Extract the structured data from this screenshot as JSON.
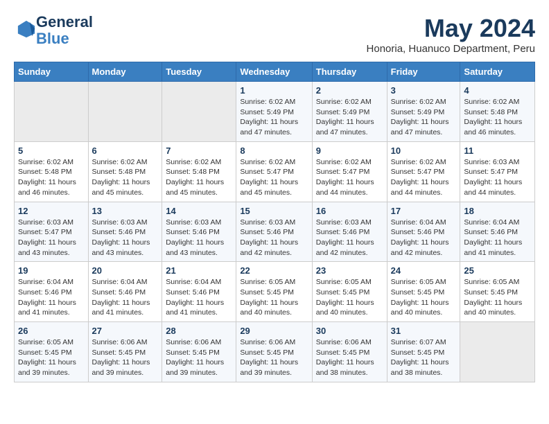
{
  "header": {
    "logo_line1": "General",
    "logo_line2": "Blue",
    "month_year": "May 2024",
    "location": "Honoria, Huanuco Department, Peru"
  },
  "days_of_week": [
    "Sunday",
    "Monday",
    "Tuesday",
    "Wednesday",
    "Thursday",
    "Friday",
    "Saturday"
  ],
  "weeks": [
    [
      {
        "day": "",
        "info": ""
      },
      {
        "day": "",
        "info": ""
      },
      {
        "day": "",
        "info": ""
      },
      {
        "day": "1",
        "info": "Sunrise: 6:02 AM\nSunset: 5:49 PM\nDaylight: 11 hours and 47 minutes."
      },
      {
        "day": "2",
        "info": "Sunrise: 6:02 AM\nSunset: 5:49 PM\nDaylight: 11 hours and 47 minutes."
      },
      {
        "day": "3",
        "info": "Sunrise: 6:02 AM\nSunset: 5:49 PM\nDaylight: 11 hours and 47 minutes."
      },
      {
        "day": "4",
        "info": "Sunrise: 6:02 AM\nSunset: 5:48 PM\nDaylight: 11 hours and 46 minutes."
      }
    ],
    [
      {
        "day": "5",
        "info": "Sunrise: 6:02 AM\nSunset: 5:48 PM\nDaylight: 11 hours and 46 minutes."
      },
      {
        "day": "6",
        "info": "Sunrise: 6:02 AM\nSunset: 5:48 PM\nDaylight: 11 hours and 45 minutes."
      },
      {
        "day": "7",
        "info": "Sunrise: 6:02 AM\nSunset: 5:48 PM\nDaylight: 11 hours and 45 minutes."
      },
      {
        "day": "8",
        "info": "Sunrise: 6:02 AM\nSunset: 5:47 PM\nDaylight: 11 hours and 45 minutes."
      },
      {
        "day": "9",
        "info": "Sunrise: 6:02 AM\nSunset: 5:47 PM\nDaylight: 11 hours and 44 minutes."
      },
      {
        "day": "10",
        "info": "Sunrise: 6:02 AM\nSunset: 5:47 PM\nDaylight: 11 hours and 44 minutes."
      },
      {
        "day": "11",
        "info": "Sunrise: 6:03 AM\nSunset: 5:47 PM\nDaylight: 11 hours and 44 minutes."
      }
    ],
    [
      {
        "day": "12",
        "info": "Sunrise: 6:03 AM\nSunset: 5:47 PM\nDaylight: 11 hours and 43 minutes."
      },
      {
        "day": "13",
        "info": "Sunrise: 6:03 AM\nSunset: 5:46 PM\nDaylight: 11 hours and 43 minutes."
      },
      {
        "day": "14",
        "info": "Sunrise: 6:03 AM\nSunset: 5:46 PM\nDaylight: 11 hours and 43 minutes."
      },
      {
        "day": "15",
        "info": "Sunrise: 6:03 AM\nSunset: 5:46 PM\nDaylight: 11 hours and 42 minutes."
      },
      {
        "day": "16",
        "info": "Sunrise: 6:03 AM\nSunset: 5:46 PM\nDaylight: 11 hours and 42 minutes."
      },
      {
        "day": "17",
        "info": "Sunrise: 6:04 AM\nSunset: 5:46 PM\nDaylight: 11 hours and 42 minutes."
      },
      {
        "day": "18",
        "info": "Sunrise: 6:04 AM\nSunset: 5:46 PM\nDaylight: 11 hours and 41 minutes."
      }
    ],
    [
      {
        "day": "19",
        "info": "Sunrise: 6:04 AM\nSunset: 5:46 PM\nDaylight: 11 hours and 41 minutes."
      },
      {
        "day": "20",
        "info": "Sunrise: 6:04 AM\nSunset: 5:46 PM\nDaylight: 11 hours and 41 minutes."
      },
      {
        "day": "21",
        "info": "Sunrise: 6:04 AM\nSunset: 5:46 PM\nDaylight: 11 hours and 41 minutes."
      },
      {
        "day": "22",
        "info": "Sunrise: 6:05 AM\nSunset: 5:45 PM\nDaylight: 11 hours and 40 minutes."
      },
      {
        "day": "23",
        "info": "Sunrise: 6:05 AM\nSunset: 5:45 PM\nDaylight: 11 hours and 40 minutes."
      },
      {
        "day": "24",
        "info": "Sunrise: 6:05 AM\nSunset: 5:45 PM\nDaylight: 11 hours and 40 minutes."
      },
      {
        "day": "25",
        "info": "Sunrise: 6:05 AM\nSunset: 5:45 PM\nDaylight: 11 hours and 40 minutes."
      }
    ],
    [
      {
        "day": "26",
        "info": "Sunrise: 6:05 AM\nSunset: 5:45 PM\nDaylight: 11 hours and 39 minutes."
      },
      {
        "day": "27",
        "info": "Sunrise: 6:06 AM\nSunset: 5:45 PM\nDaylight: 11 hours and 39 minutes."
      },
      {
        "day": "28",
        "info": "Sunrise: 6:06 AM\nSunset: 5:45 PM\nDaylight: 11 hours and 39 minutes."
      },
      {
        "day": "29",
        "info": "Sunrise: 6:06 AM\nSunset: 5:45 PM\nDaylight: 11 hours and 39 minutes."
      },
      {
        "day": "30",
        "info": "Sunrise: 6:06 AM\nSunset: 5:45 PM\nDaylight: 11 hours and 38 minutes."
      },
      {
        "day": "31",
        "info": "Sunrise: 6:07 AM\nSunset: 5:45 PM\nDaylight: 11 hours and 38 minutes."
      },
      {
        "day": "",
        "info": ""
      }
    ]
  ]
}
